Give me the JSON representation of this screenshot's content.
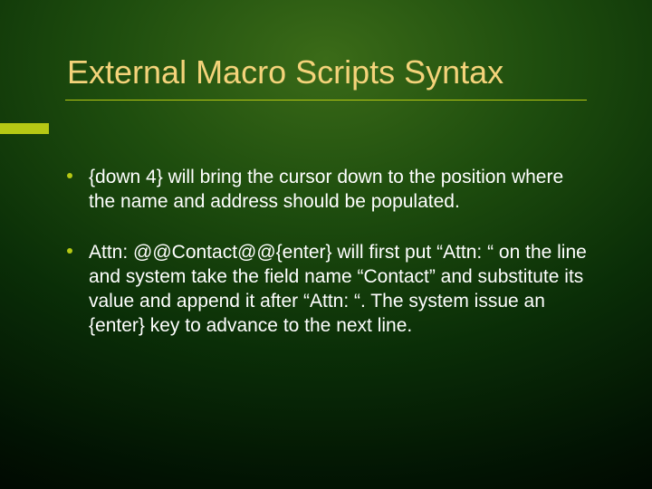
{
  "title": "External Macro Scripts Syntax",
  "bullets": [
    "{down 4} will bring the cursor down to the position where the name and address should be populated.",
    "Attn: @@Contact@@{enter} will first put “Attn: “ on the line and system take the field name “Contact” and substitute its value and append it after “Attn: “.  The system issue an {enter} key to advance to the next line."
  ],
  "colors": {
    "accent": "#b6c814",
    "title": "#f4d37a",
    "body_text": "#ffffff"
  }
}
